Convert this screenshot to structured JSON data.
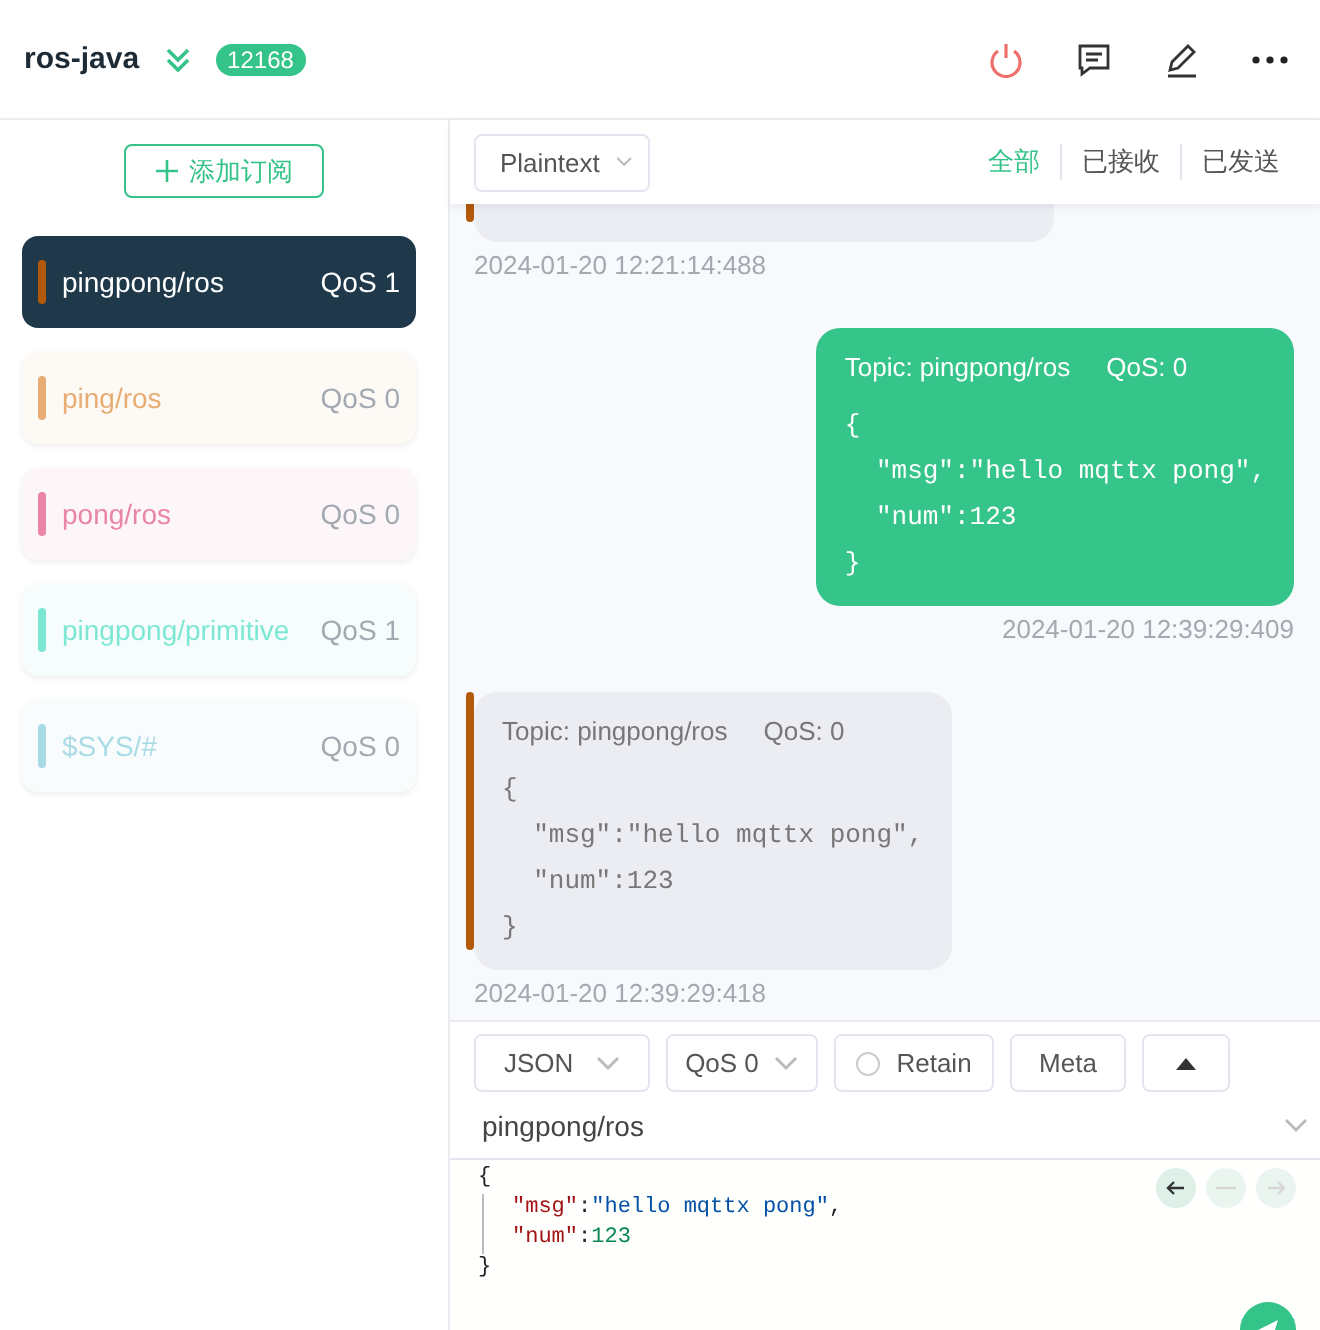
{
  "header": {
    "title": "ros-java",
    "badge": "12168"
  },
  "sidebar": {
    "add_button": "添加订阅",
    "subscriptions": [
      {
        "topic": "pingpong/ros",
        "qos": "QoS 1",
        "color": "#b35a0a",
        "selected": true
      },
      {
        "topic": "ping/ros",
        "qos": "QoS 0",
        "color": "#e8ad74",
        "selected": false
      },
      {
        "topic": "pong/ros",
        "qos": "QoS 0",
        "color": "#e985a8",
        "selected": false
      },
      {
        "topic": "pingpong/primitive",
        "qos": "QoS 1",
        "color": "#7ce8d4",
        "selected": false
      },
      {
        "topic": "$SYS/#",
        "qos": "QoS 0",
        "color": "#a9dbe6",
        "selected": false
      }
    ]
  },
  "toolbar": {
    "format": "Plaintext",
    "filters": [
      {
        "label": "全部",
        "selected": true
      },
      {
        "label": "已接收",
        "selected": false
      },
      {
        "label": "已发送",
        "selected": false
      }
    ]
  },
  "messages": [
    {
      "kind": "received",
      "partial": true,
      "time": "2024-01-20 12:21:14:488"
    },
    {
      "kind": "sent",
      "partial": false,
      "topic": "Topic: pingpong/ros",
      "qos": "QoS: 0",
      "lines": [
        "{",
        "  \"msg\":\"hello mqttx pong\",",
        "  \"num\":123",
        "}"
      ],
      "time": "2024-01-20 12:39:29:409"
    },
    {
      "kind": "received",
      "partial": false,
      "topic": "Topic: pingpong/ros",
      "qos": "QoS: 0",
      "lines": [
        "{",
        "  \"msg\":\"hello mqttx pong\",",
        "  \"num\":123",
        "}"
      ],
      "time": "2024-01-20 12:39:29:418"
    }
  ],
  "composer": {
    "format": "JSON",
    "qos": "QoS 0",
    "retain": {
      "label": "Retain",
      "checked": false
    },
    "meta_button": "Meta",
    "topic": "pingpong/ros",
    "editor_lines": [
      [
        {
          "kind": "punct",
          "text": "{"
        }
      ],
      [
        {
          "kind": "key",
          "text": "\"msg\""
        },
        {
          "kind": "punct",
          "text": ":"
        },
        {
          "kind": "string",
          "text": "\"hello mqttx pong\""
        },
        {
          "kind": "punct",
          "text": ","
        }
      ],
      [
        {
          "kind": "key",
          "text": "\"num\""
        },
        {
          "kind": "punct",
          "text": ":"
        },
        {
          "kind": "number",
          "text": "123"
        }
      ],
      [
        {
          "kind": "punct",
          "text": "}"
        }
      ]
    ]
  }
}
